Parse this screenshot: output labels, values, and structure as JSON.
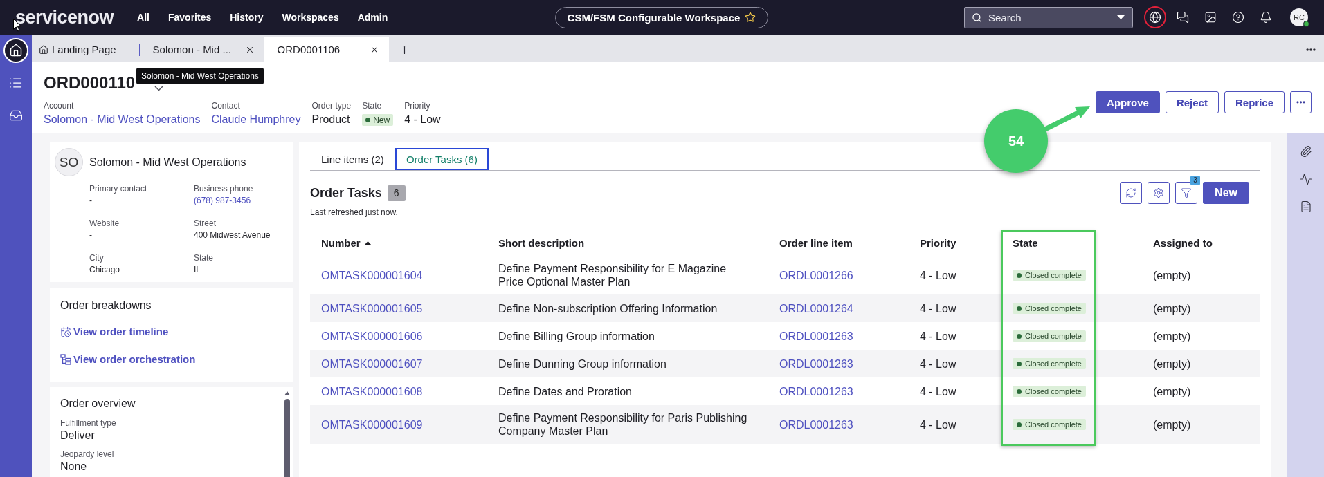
{
  "top_nav": {
    "logo": "servicenow",
    "menu": [
      {
        "label": "All"
      },
      {
        "label": "Favorites"
      },
      {
        "label": "History"
      },
      {
        "label": "Workspaces"
      },
      {
        "label": "Admin"
      }
    ],
    "workspace": "CSM/FSM Configurable Workspace",
    "search": {
      "placeholder": "Search"
    },
    "avatar": {
      "initials": "RC",
      "online": true
    }
  },
  "rail": [
    {
      "kind": "home",
      "selected": true
    },
    {
      "kind": "list",
      "selected": false
    },
    {
      "kind": "inbox",
      "selected": false
    }
  ],
  "tabs": [
    {
      "label": "Landing Page",
      "kind": "home",
      "selected": false
    },
    {
      "label": "Solomon - Mid ...",
      "kind": "record",
      "selected": false
    },
    {
      "label": "ORD0001106",
      "kind": "record",
      "selected": true
    }
  ],
  "tooltip": "Solomon - Mid West Operations",
  "record": {
    "title": "ORD000110",
    "fields": [
      {
        "label": "Account",
        "value": "Solomon - Mid West Operations",
        "kind": "link"
      },
      {
        "label": "Contact",
        "value": "Claude Humphrey",
        "kind": "link"
      },
      {
        "label": "Order type",
        "value": "Product",
        "kind": "text"
      },
      {
        "label": "State",
        "value": "New",
        "kind": "badge"
      },
      {
        "label": "Priority",
        "value": "4 - Low",
        "kind": "text"
      }
    ],
    "actions": [
      {
        "label": "Approve",
        "primary": true
      },
      {
        "label": "Reject",
        "primary": false
      },
      {
        "label": "Reprice",
        "primary": false
      }
    ]
  },
  "account_card": {
    "initials": "SO",
    "name": "Solomon - Mid West Operations",
    "fields": [
      {
        "label": "Primary contact",
        "value": "-",
        "kind": "text"
      },
      {
        "label": "Business phone",
        "value": "(678) 987-3456",
        "kind": "link"
      },
      {
        "label": "Website",
        "value": "-",
        "kind": "text"
      },
      {
        "label": "Street",
        "value": "400 Midwest Avenue",
        "kind": "text"
      },
      {
        "label": "City",
        "value": "Chicago",
        "kind": "text"
      },
      {
        "label": "State",
        "value": "IL",
        "kind": "text"
      }
    ]
  },
  "order_breakdowns": {
    "title": "Order breakdowns",
    "links": [
      {
        "label": "View order timeline",
        "kind": "timeline"
      },
      {
        "label": "View order orchestration",
        "kind": "orchestration"
      }
    ]
  },
  "order_overview": {
    "title": "Order overview",
    "fields": [
      {
        "label": "Fulfillment type",
        "value": "Deliver"
      },
      {
        "label": "Jeopardy level",
        "value": "None"
      }
    ]
  },
  "related_tabs": [
    {
      "label": "Line items (2)",
      "selected": false
    },
    {
      "label": "Order Tasks (6)",
      "selected": true
    }
  ],
  "order_tasks": {
    "title": "Order Tasks",
    "count": "6",
    "subtitle": "Last refreshed just now.",
    "filter_count": "3",
    "new_button": "New",
    "columns": [
      {
        "label": "Number",
        "kind": "link",
        "sorted": true
      },
      {
        "label": "Short description",
        "kind": "text",
        "sorted": false
      },
      {
        "label": "Order line item",
        "kind": "link",
        "sorted": false
      },
      {
        "label": "Priority",
        "kind": "text",
        "sorted": false
      },
      {
        "label": "State",
        "kind": "status",
        "sorted": false
      },
      {
        "label": "Assigned to",
        "kind": "text",
        "sorted": false
      }
    ],
    "rows": [
      {
        "cells": [
          "OMTASK000001604",
          "Define Payment Responsibility for E Magazine Price Optional Master Plan",
          "ORDL0001266",
          "4 - Low",
          "Closed complete",
          "(empty)"
        ]
      },
      {
        "cells": [
          "OMTASK000001605",
          "Define Non-subscription Offering Information",
          "ORDL0001264",
          "4 - Low",
          "Closed complete",
          "(empty)"
        ]
      },
      {
        "cells": [
          "OMTASK000001606",
          "Define Billing Group information",
          "ORDL0001263",
          "4 - Low",
          "Closed complete",
          "(empty)"
        ]
      },
      {
        "cells": [
          "OMTASK000001607",
          "Define Dunning Group information",
          "ORDL0001263",
          "4 - Low",
          "Closed complete",
          "(empty)"
        ]
      },
      {
        "cells": [
          "OMTASK000001608",
          "Define Dates and Proration",
          "ORDL0001263",
          "4 - Low",
          "Closed complete",
          "(empty)"
        ]
      },
      {
        "cells": [
          "OMTASK000001609",
          "Define Payment Responsibility for Paris Publishing Company Master Plan",
          "ORDL0001263",
          "4 - Low",
          "Closed complete",
          "(empty)"
        ]
      }
    ]
  },
  "annotation": {
    "step": "54"
  }
}
